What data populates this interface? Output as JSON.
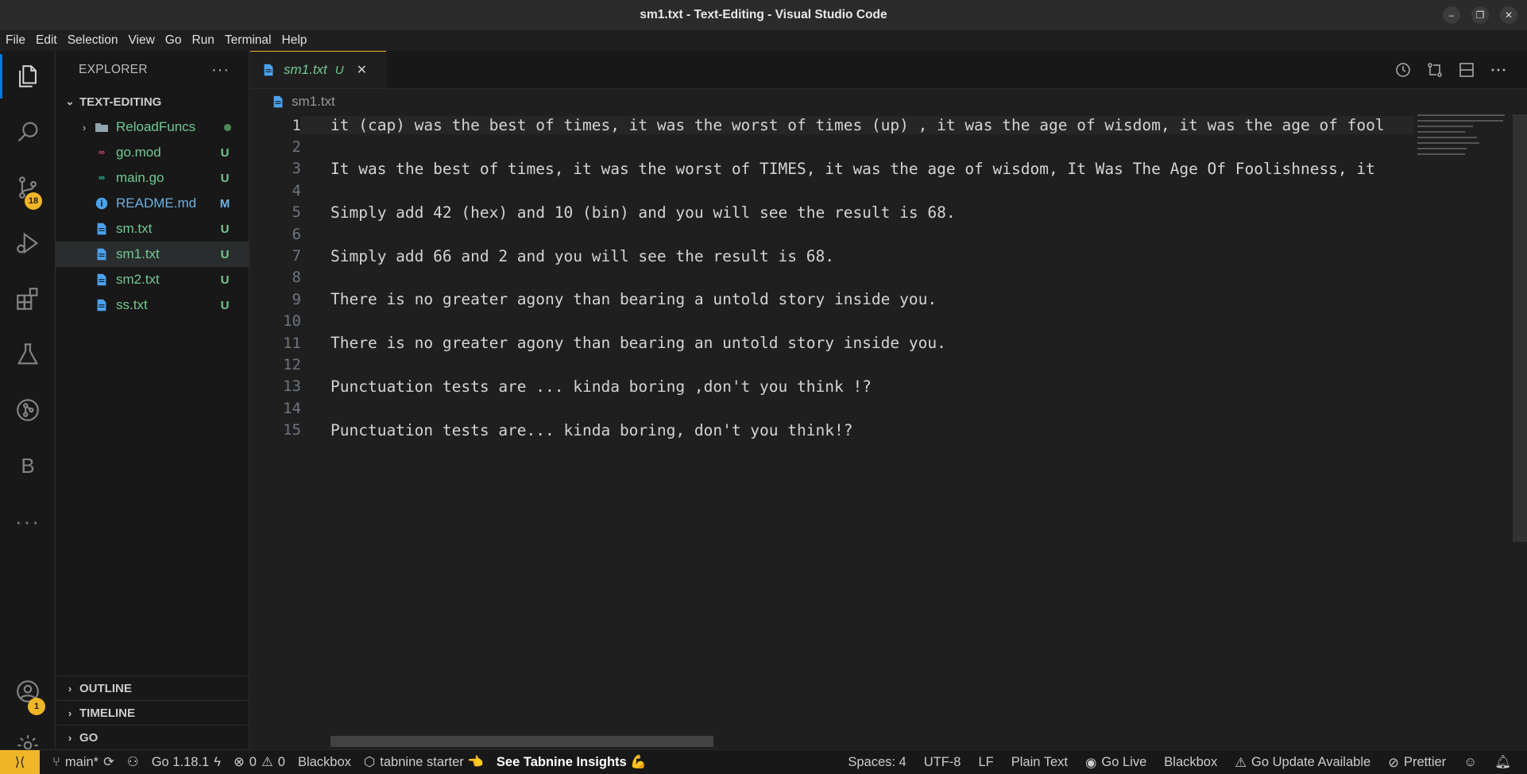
{
  "window": {
    "title": "sm1.txt - Text-Editing - Visual Studio Code"
  },
  "menu": [
    "File",
    "Edit",
    "Selection",
    "View",
    "Go",
    "Run",
    "Terminal",
    "Help"
  ],
  "activity": {
    "scm_badge": "18",
    "account_badge": "1",
    "blackbox_letter": "B"
  },
  "sidebar": {
    "title": "EXPLORER",
    "more": "···",
    "folder": "TEXT-EDITING",
    "items": [
      {
        "name": "ReloadFuncs",
        "type": "folder",
        "status": ""
      },
      {
        "name": "go.mod",
        "type": "go",
        "status": "U"
      },
      {
        "name": "main.go",
        "type": "go",
        "status": "U"
      },
      {
        "name": "README.md",
        "type": "info",
        "status": "M"
      },
      {
        "name": "sm.txt",
        "type": "file",
        "status": "U"
      },
      {
        "name": "sm1.txt",
        "type": "file",
        "status": "U"
      },
      {
        "name": "sm2.txt",
        "type": "file",
        "status": "U"
      },
      {
        "name": "ss.txt",
        "type": "file",
        "status": "U"
      }
    ],
    "sections": [
      "OUTLINE",
      "TIMELINE",
      "GO"
    ]
  },
  "editor": {
    "tab": {
      "name": "sm1.txt",
      "status": "U"
    },
    "breadcrumb": "sm1.txt",
    "lines": [
      "it (cap) was the best of times, it was the worst of times (up) , it was the age of wisdom, it was the age of fool",
      "",
      "It was the best of times, it was the worst of TIMES, it was the age of wisdom, It Was The Age Of Foolishness, it",
      "",
      "Simply add 42 (hex) and 10 (bin) and you will see the result is 68.",
      "",
      "Simply add 66 and 2 and you will see the result is 68.",
      "",
      "There is no greater agony than bearing a untold story inside you.",
      "",
      "There is no greater agony than bearing an untold story inside you.",
      "",
      "Punctuation tests are ... kinda boring ,don't you think !?",
      "",
      "Punctuation tests are... kinda boring, don't you think!?"
    ]
  },
  "statusbar": {
    "branch": "main*",
    "go_version": "Go 1.18.1",
    "errors": "0",
    "warnings": "0",
    "blackbox": "Blackbox",
    "tabnine": "tabnine starter 👈",
    "insights": "See Tabnine Insights 💪",
    "spaces": "Spaces: 4",
    "encoding": "UTF-8",
    "eol": "LF",
    "language": "Plain Text",
    "golive": "Go Live",
    "blackbox2": "Blackbox",
    "go_update": "Go Update Available",
    "prettier": "Prettier"
  },
  "colors": {
    "accent": "#f0b529",
    "untracked": "#73c991",
    "modified": "#6fb0e0"
  }
}
